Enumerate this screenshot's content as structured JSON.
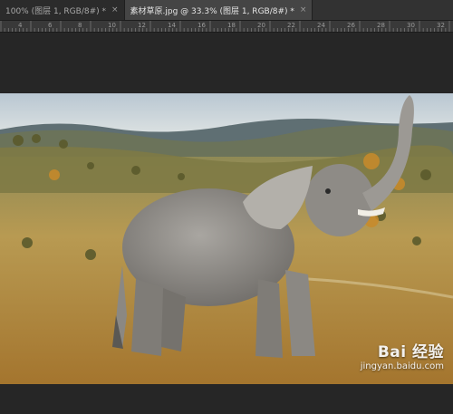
{
  "tabs": [
    {
      "label": "100% (图层 1, RGB/8#) *",
      "close": "×",
      "active": false
    },
    {
      "label": "素材草原.jpg @ 33.3% (图层 1, RGB/8#) *",
      "close": "×",
      "active": true
    }
  ],
  "ruler": {
    "labels": [
      "4",
      "6",
      "8",
      "10",
      "12",
      "14",
      "16",
      "18",
      "20",
      "22",
      "24",
      "26",
      "28",
      "30",
      "32"
    ]
  },
  "canvas": {
    "image_subject": "elephant-on-grassland",
    "colors": {
      "sky": "#c9d6df",
      "grass": "#b58a3a",
      "elephant": "#8d8a85"
    }
  },
  "watermark": {
    "main": "Bai 经验",
    "sub": "jingyan.baidu.com"
  }
}
